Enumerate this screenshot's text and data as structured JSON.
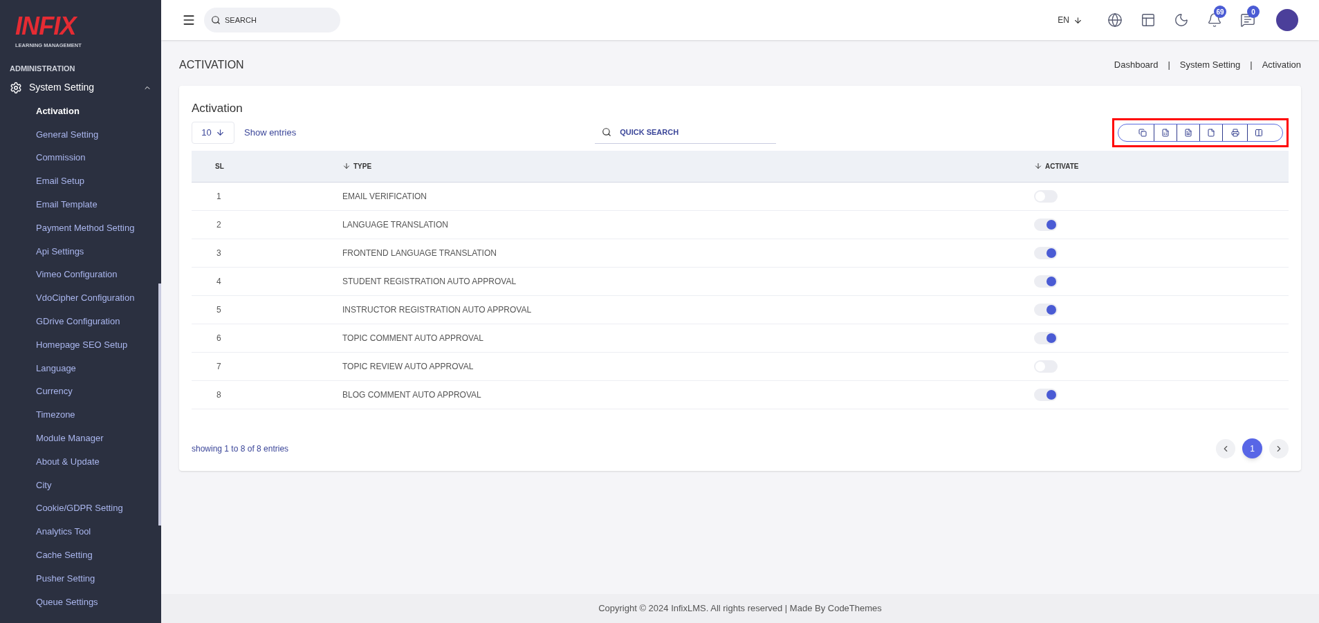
{
  "logo": {
    "mark": "INFIX",
    "subtitle": "LEARNING MANAGEMENT"
  },
  "sidebar": {
    "section": "ADMINISTRATION",
    "group": {
      "label": "System Setting",
      "expanded": true,
      "items": [
        {
          "label": "Activation",
          "selected": true
        },
        {
          "label": "General Setting",
          "selected": false
        },
        {
          "label": "Commission",
          "selected": false
        },
        {
          "label": "Email Setup",
          "selected": false
        },
        {
          "label": "Email Template",
          "selected": false
        },
        {
          "label": "Payment Method Setting",
          "selected": false
        },
        {
          "label": "Api Settings",
          "selected": false
        },
        {
          "label": "Vimeo Configuration",
          "selected": false
        },
        {
          "label": "VdoCipher Configuration",
          "selected": false
        },
        {
          "label": "GDrive Configuration",
          "selected": false
        },
        {
          "label": "Homepage SEO Setup",
          "selected": false
        },
        {
          "label": "Language",
          "selected": false
        },
        {
          "label": "Currency",
          "selected": false
        },
        {
          "label": "Timezone",
          "selected": false
        },
        {
          "label": "Module Manager",
          "selected": false
        },
        {
          "label": "About & Update",
          "selected": false
        },
        {
          "label": "City",
          "selected": false
        },
        {
          "label": "Cookie/GDPR Setting",
          "selected": false
        },
        {
          "label": "Analytics Tool",
          "selected": false
        },
        {
          "label": "Cache Setting",
          "selected": false
        },
        {
          "label": "Pusher Setting",
          "selected": false
        },
        {
          "label": "Queue Settings",
          "selected": false
        }
      ]
    }
  },
  "topbar": {
    "search": {
      "placeholder": "SEARCH"
    },
    "language": "EN",
    "notifications": "69",
    "messages": "0"
  },
  "page": {
    "title": "ACTIVATION",
    "breadcrumb": [
      {
        "kind": "link",
        "text": "Dashboard"
      },
      {
        "kind": "separator",
        "text": "|"
      },
      {
        "kind": "link",
        "text": "System Setting"
      },
      {
        "kind": "separator",
        "text": "|"
      },
      {
        "kind": "link",
        "text": "Activation"
      }
    ]
  },
  "card": {
    "title": "Activation",
    "entries": {
      "value": "10",
      "label": "Show entries"
    },
    "quick_search": {
      "placeholder": "QUICK SEARCH"
    },
    "export_toolbar": {
      "highlighted": true
    },
    "table": {
      "columns": [
        {
          "label": "SL",
          "sortable": false
        },
        {
          "label": "TYPE",
          "sortable": true
        },
        {
          "label": "ACTIVATE",
          "sortable": true
        }
      ],
      "rows": [
        {
          "sl": "1",
          "type": "EMAIL VERIFICATION",
          "on": false
        },
        {
          "sl": "2",
          "type": "LANGUAGE TRANSLATION",
          "on": true
        },
        {
          "sl": "3",
          "type": "FRONTEND LANGUAGE TRANSLATION",
          "on": true
        },
        {
          "sl": "4",
          "type": "STUDENT REGISTRATION AUTO APPROVAL",
          "on": true
        },
        {
          "sl": "5",
          "type": "INSTRUCTOR REGISTRATION AUTO APPROVAL",
          "on": true
        },
        {
          "sl": "6",
          "type": "TOPIC COMMENT AUTO APPROVAL",
          "on": true
        },
        {
          "sl": "7",
          "type": "TOPIC REVIEW AUTO APPROVAL",
          "on": false
        },
        {
          "sl": "8",
          "type": "BLOG COMMENT AUTO APPROVAL",
          "on": true
        }
      ]
    },
    "summary": "showing 1 to 8 of 8 entries",
    "pagination": [
      {
        "label": "1",
        "selected": true
      }
    ]
  },
  "footer": {
    "text": "Copyright © 2024 InfixLMS. All rights reserved | Made By CodeThemes"
  }
}
